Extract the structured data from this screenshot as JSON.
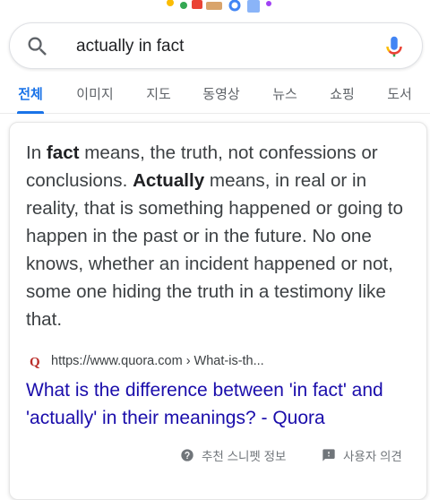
{
  "search": {
    "query": "actually in fact"
  },
  "tabs": [
    {
      "label": "전체",
      "active": true
    },
    {
      "label": "이미지"
    },
    {
      "label": "지도"
    },
    {
      "label": "동영상"
    },
    {
      "label": "뉴스"
    },
    {
      "label": "쇼핑"
    },
    {
      "label": "도서"
    }
  ],
  "snippet": {
    "parts": [
      "In ",
      "fact",
      " means, the truth, not confessions or conclusions. ",
      "Actually",
      " means, in real or in reality, that is something happened or going to happen in the past or in the future. No one knows, whether an incident happened or not, some one hiding the truth in a testimony like that."
    ]
  },
  "source": {
    "favicon_letter": "Q",
    "url": "https://www.quora.com › What-is-th..."
  },
  "result": {
    "title": "What is the difference between 'in fact' and 'actually' in their meanings? - Quora"
  },
  "footer": {
    "about_label": "추천 스니펫 정보",
    "feedback_label": "사용자 의견"
  },
  "colors": {
    "accent": "#1a73e8",
    "link": "#1a0dab",
    "quora": "#b92b27"
  },
  "icons": [
    "search-icon",
    "mic-icon",
    "help-icon",
    "feedback-icon",
    "quora-favicon"
  ]
}
